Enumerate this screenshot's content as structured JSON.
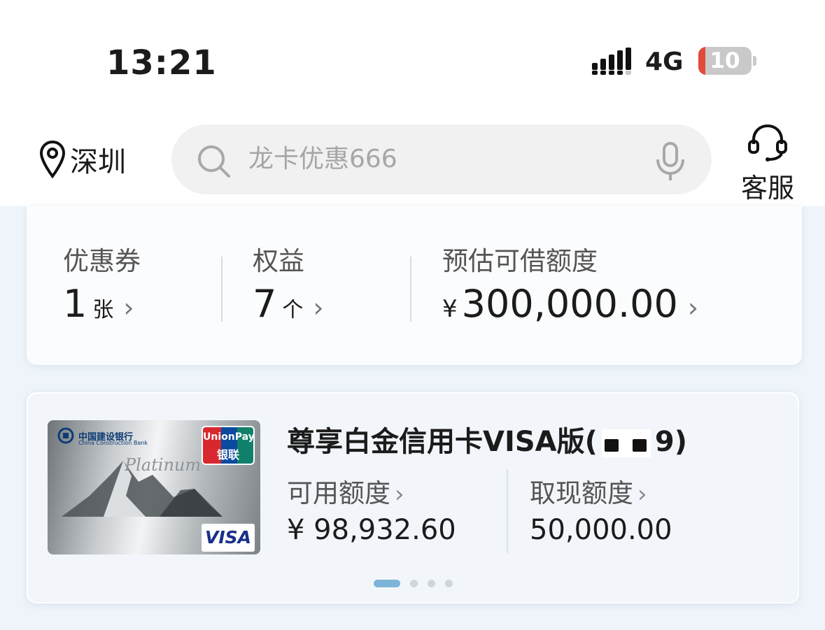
{
  "status_bar": {
    "time": "13:21",
    "network": "4G",
    "battery_level": "10",
    "battery_color": "#e24a3b"
  },
  "header": {
    "location_icon": "location-pin-icon",
    "location": "深圳",
    "search": {
      "icon": "search-icon",
      "placeholder": "龙卡优惠666",
      "voice_icon": "microphone-icon"
    },
    "service": {
      "icon": "headset-icon",
      "label": "客服"
    }
  },
  "summary": {
    "coupons": {
      "label": "优惠券",
      "value": "1",
      "unit": "张"
    },
    "benefits": {
      "label": "权益",
      "value": "7",
      "unit": "个"
    },
    "credit": {
      "label": "预估可借额度",
      "currency": "¥",
      "value": "300,000.00"
    },
    "chevron": "›"
  },
  "card": {
    "image": {
      "bank_name_cn": "中国建设银行",
      "bank_name_en": "China Construction Bank",
      "unionpay_en": "UnionPay",
      "unionpay_cn": "银联",
      "card_tier": "Platinum",
      "network": "VISA"
    },
    "title_prefix": "尊享白金信用卡VISA版(",
    "title_suffix": "9)",
    "available": {
      "label": "可用额度",
      "value": "¥ 98,932.60"
    },
    "cash": {
      "label": "取现额度",
      "value": "50,000.00"
    },
    "chevron": "›",
    "pagination": {
      "total": 4,
      "active": 1
    }
  }
}
